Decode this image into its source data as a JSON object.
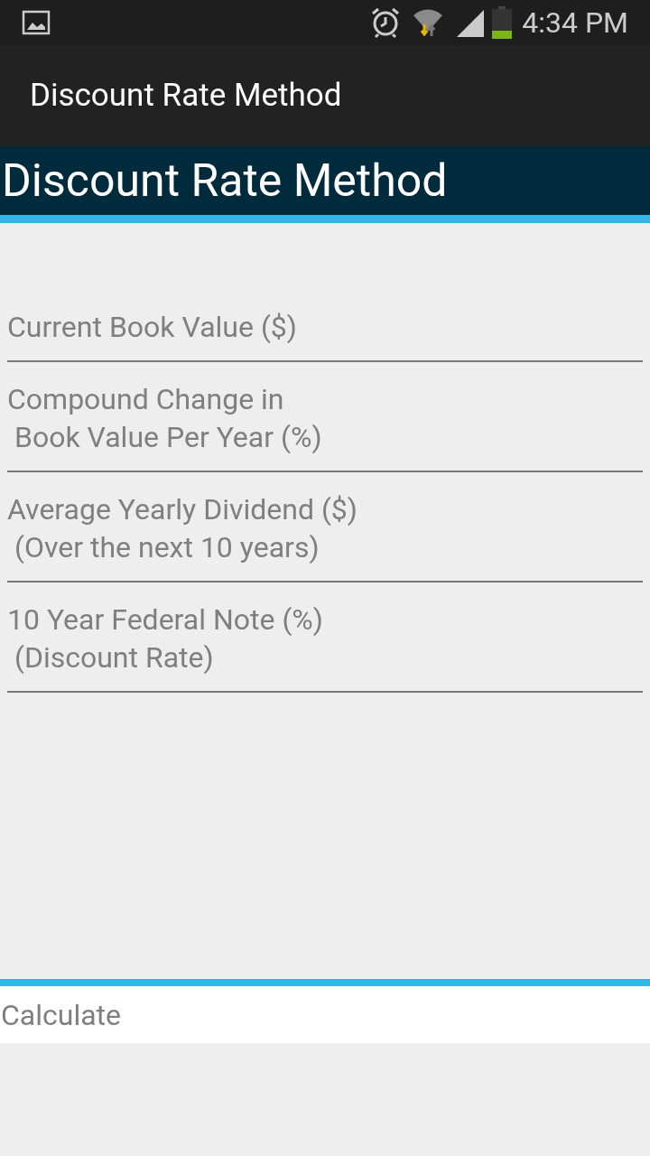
{
  "status_bar": {
    "time": "4:34 PM"
  },
  "action_bar": {
    "title": "Discount Rate Method"
  },
  "header": {
    "title": "Discount Rate Method"
  },
  "fields": [
    {
      "placeholder": "Current Book Value ($)"
    },
    {
      "placeholder": "Compound Change in\n Book Value Per Year (%)"
    },
    {
      "placeholder": "Average Yearly Dividend ($)\n (Over the next 10 years)"
    },
    {
      "placeholder": "10 Year Federal Note (%)\n (Discount Rate)"
    }
  ],
  "calculate_button": {
    "label": "Calculate"
  }
}
